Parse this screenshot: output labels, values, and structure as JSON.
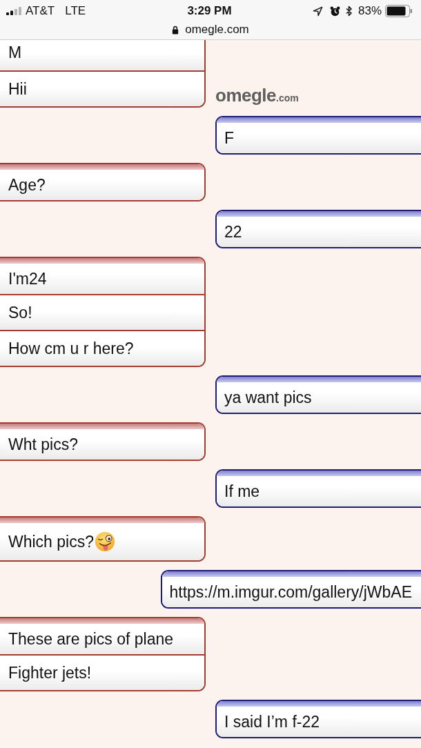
{
  "status_bar": {
    "carrier": "AT&T",
    "network": "LTE",
    "time": "3:29 PM",
    "battery": "83%",
    "url": "omegle.com"
  },
  "logo": {
    "text": "omegle",
    "suffix": ".com"
  },
  "messages": [
    {
      "kind": "stranger",
      "lines": [
        {
          "text": "M",
          "emoji": false
        },
        {
          "text": "Hii",
          "emoji": false
        }
      ]
    },
    {
      "kind": "you",
      "lines": [
        {
          "text": "F",
          "emoji": false
        }
      ]
    },
    {
      "kind": "stranger",
      "lines": [
        {
          "text": "Age?",
          "emoji": false
        }
      ]
    },
    {
      "kind": "you",
      "lines": [
        {
          "text": "22",
          "emoji": false
        }
      ]
    },
    {
      "kind": "stranger",
      "lines": [
        {
          "text": "I'm24",
          "emoji": false
        },
        {
          "text": "So!",
          "emoji": false
        },
        {
          "text": "How cm u r here?",
          "emoji": false
        }
      ]
    },
    {
      "kind": "you",
      "lines": [
        {
          "text": "ya want pics",
          "emoji": false
        }
      ]
    },
    {
      "kind": "stranger",
      "lines": [
        {
          "text": "Wht pics?",
          "emoji": false
        }
      ]
    },
    {
      "kind": "you",
      "lines": [
        {
          "text": "If me",
          "emoji": false
        }
      ]
    },
    {
      "kind": "stranger",
      "lines": [
        {
          "text": "Which pics?",
          "emoji": true
        }
      ]
    },
    {
      "kind": "you",
      "lines": [
        {
          "text": "https://m.imgur.com/gallery/jWbAE",
          "emoji": false
        }
      ]
    },
    {
      "kind": "stranger",
      "lines": [
        {
          "text": "These are pics of plane",
          "emoji": false
        },
        {
          "text": "Fighter jets!",
          "emoji": false
        }
      ]
    },
    {
      "kind": "you",
      "lines": [
        {
          "text": "I said I’m f-22",
          "emoji": false
        }
      ]
    }
  ]
}
